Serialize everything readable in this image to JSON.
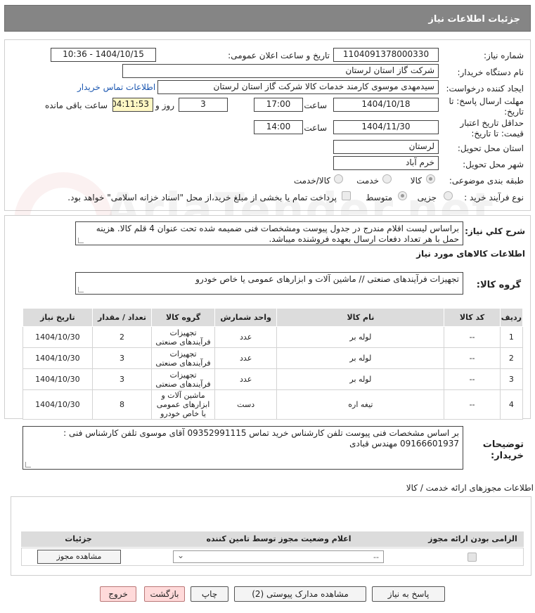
{
  "header": {
    "title": "جزئیات اطلاعات نیاز"
  },
  "watermark": {
    "text": "AriaTender.net"
  },
  "form": {
    "need_number_label": "شماره نیاز:",
    "need_number": "1104091378000330",
    "announce_label": "تاریخ و ساعت اعلان عمومی:",
    "announce_value": "1404/10/15 - 10:36",
    "buyer_org_label": "نام دستگاه خریدار:",
    "buyer_org": "شرکت گاز استان لرستان",
    "creator_label": "ایجاد کننده درخواست:",
    "creator": "سیدمهدی موسوی کارمند خدمات کالا شرکت گاز استان لرستان",
    "contact_link": "اطلاعات تماس خریدار",
    "deadline_label_1": "مهلت ارسال پاسخ: تا",
    "deadline_label_2": "تاریخ:",
    "deadline_date": "1404/10/18",
    "time_label": "ساعت",
    "deadline_time": "17:00",
    "days": "3",
    "days_label": "روز و",
    "remaining": "04:11:53",
    "remaining_label": "ساعت باقی مانده",
    "validity_label_1": "حداقل تاریخ اعتبار",
    "validity_label_2": "قیمت: تا تاریخ:",
    "validity_date": "1404/11/30",
    "validity_time": "14:00",
    "province_label": "استان محل تحویل:",
    "province": "لرستان",
    "city_label": "شهر محل تحویل:",
    "city": "خرم آباد",
    "category_label": "طبقه بندی موضوعی:",
    "category_options": [
      "کالا",
      "خدمت",
      "کالا/خدمت"
    ],
    "purchase_type_label": "نوع فرآیند خرید :",
    "purchase_options": [
      "جزیی",
      "متوسط"
    ],
    "payment_note": "پرداخت تمام یا بخشی از مبلغ خرید،از محل \"اسناد خزانه اسلامی\" خواهد بود."
  },
  "description": {
    "label": "شرح کلي نياز:",
    "text": "براساس لیست اقلام مندرج در جدول پیوست ومشخصات فنی ضمیمه شده تحت عنوان 4 قلم کالا. هزینه حمل با هر تعداد دفعات ارسال بعهده فروشنده میباشد."
  },
  "goods_section": {
    "title": "اطلاعات کالاهای مورد نیاز",
    "group_label": "گروه کالا:",
    "group_value": "تجهیزات فرآیندهای صنعتی //  ماشین آلات و ابزارهای عمومی یا خاص خودرو"
  },
  "items_table": {
    "headers": [
      "ردیف",
      "کد کالا",
      "نام کالا",
      "واحد شمارش",
      "گروه کالا",
      "تعداد / مقدار",
      "تاریخ نیاز"
    ],
    "rows": [
      {
        "row": "1",
        "code": "--",
        "name": "لوله بر",
        "unit": "عدد",
        "group": "تجهیزات فرآیندهای صنعتی",
        "qty": "2",
        "date": "1404/10/30"
      },
      {
        "row": "2",
        "code": "--",
        "name": "لوله بر",
        "unit": "عدد",
        "group": "تجهیزات فرآیندهای صنعتی",
        "qty": "3",
        "date": "1404/10/30"
      },
      {
        "row": "3",
        "code": "--",
        "name": "لوله بر",
        "unit": "عدد",
        "group": "تجهیزات فرآیندهای صنعتی",
        "qty": "3",
        "date": "1404/10/30"
      },
      {
        "row": "4",
        "code": "--",
        "name": "تیغه اره",
        "unit": "دست",
        "group": "ماشین آلات و ابزارهای عمومی یا خاص خودرو",
        "qty": "8",
        "date": "1404/10/30"
      }
    ]
  },
  "buyer_notes": {
    "label_1": "توضیحات",
    "label_2": "خریدار:",
    "text": "بر اساس مشخصات فنی پیوست تلفن کارشناس خرید تماس 09352991115 آقای موسوی تلفن کارشناس فنی : 09166601937 مهندس قبادی"
  },
  "permits": {
    "title": "اطلاعات مجوزهای ارائه خدمت / کالا",
    "headers": [
      "الزامی بودن ارائه مجوز",
      "اعلام وضعیت مجوز توسط تامین کننده",
      "جزئیات"
    ],
    "select_value": "--",
    "view_button": "مشاهده مجوز"
  },
  "actions": {
    "reply": "پاسخ به نیاز",
    "attachments": "مشاهده مدارک پیوستی (2)",
    "print": "چاپ",
    "back": "بازگشت",
    "exit": "خروج"
  }
}
